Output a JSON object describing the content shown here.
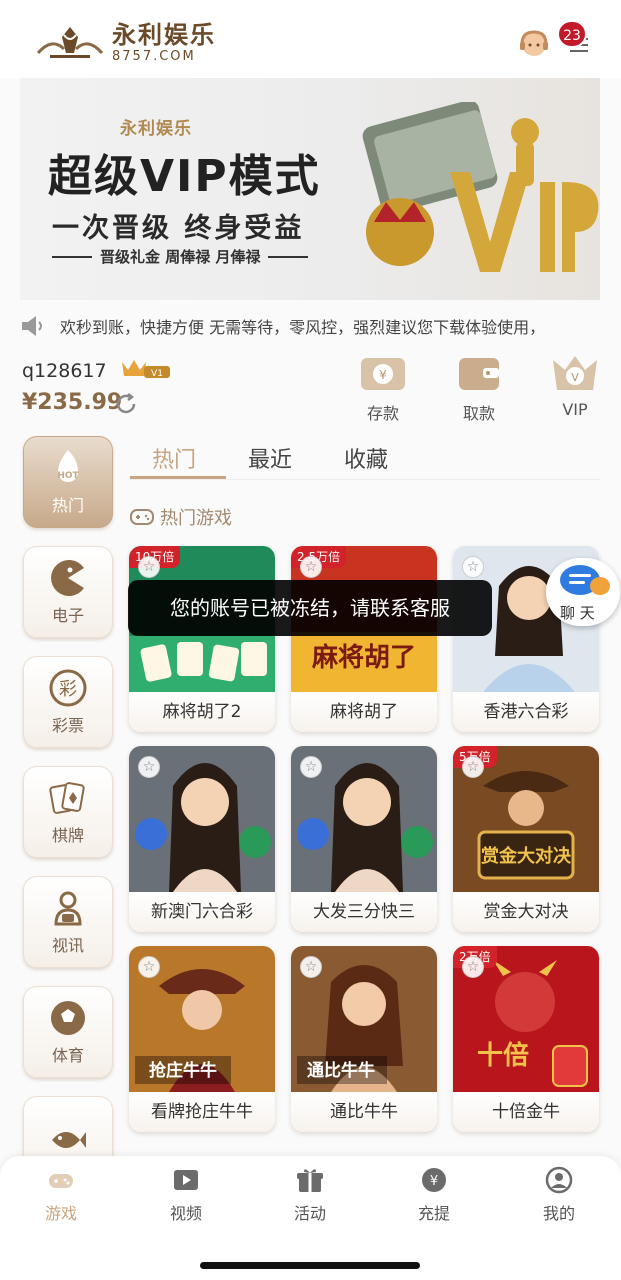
{
  "header": {
    "brand_name": "永利娱乐",
    "brand_url": "8757.COM",
    "notification_count": "23"
  },
  "banner": {
    "brand": "永利娱乐",
    "title": "超级VIP模式",
    "subtitle": "一次晋级 终身受益",
    "tagline": "晋级礼金 周俸禄 月俸禄",
    "art_text": "VIP"
  },
  "marquee": {
    "text": "欢秒到账，快捷方便 无需等待，零风控，强烈建议您下载体验使用，"
  },
  "account": {
    "username": "q128617",
    "vip_level": "V1",
    "balance": "¥235.99"
  },
  "quick_actions": [
    {
      "label": "存款",
      "icon": "deposit-icon"
    },
    {
      "label": "取款",
      "icon": "withdraw-icon"
    },
    {
      "label": "VIP",
      "icon": "vip-icon"
    }
  ],
  "categories": [
    {
      "label": "热门",
      "badge": "HOT",
      "icon": "hot-fire-icon",
      "active": true
    },
    {
      "label": "电子",
      "icon": "pacman-icon"
    },
    {
      "label": "彩票",
      "icon": "lottery-icon",
      "glyph": "彩"
    },
    {
      "label": "棋牌",
      "icon": "cards-icon"
    },
    {
      "label": "视讯",
      "icon": "live-video-icon"
    },
    {
      "label": "体育",
      "icon": "soccer-ball-icon"
    },
    {
      "label": "",
      "icon": "fish-icon"
    }
  ],
  "tabs": [
    {
      "label": "热门",
      "active": true
    },
    {
      "label": "最近"
    },
    {
      "label": "收藏"
    }
  ],
  "section_title": "热门游戏",
  "games": [
    {
      "name": "麻将胡了2",
      "ribbon": "10万倍"
    },
    {
      "name": "麻将胡了",
      "ribbon": "2.5万倍"
    },
    {
      "name": "香港六合彩",
      "ribbon": ""
    },
    {
      "name": "新澳门六合彩",
      "ribbon": ""
    },
    {
      "name": "大发三分快三",
      "ribbon": ""
    },
    {
      "name": "赏金大对决",
      "ribbon": "5万倍"
    },
    {
      "name": "看牌抢庄牛牛",
      "ribbon": ""
    },
    {
      "name": "通比牛牛",
      "ribbon": ""
    },
    {
      "name": "十倍金牛",
      "ribbon": "2万倍"
    }
  ],
  "toast": "您的账号已被冻结，请联系客服",
  "chat_label": "聊 天",
  "bottom_nav": [
    {
      "label": "游戏",
      "icon": "gamepad-icon",
      "active": true
    },
    {
      "label": "视频",
      "icon": "video-icon"
    },
    {
      "label": "活动",
      "icon": "gift-icon"
    },
    {
      "label": "充提",
      "icon": "yen-coin-icon"
    },
    {
      "label": "我的",
      "icon": "user-icon"
    }
  ],
  "colors": {
    "accent_gold": "#c9a480",
    "brand_brown": "#6b4a2a",
    "badge_red": "#c21a2a",
    "ribbon_red": "#d2232a"
  }
}
